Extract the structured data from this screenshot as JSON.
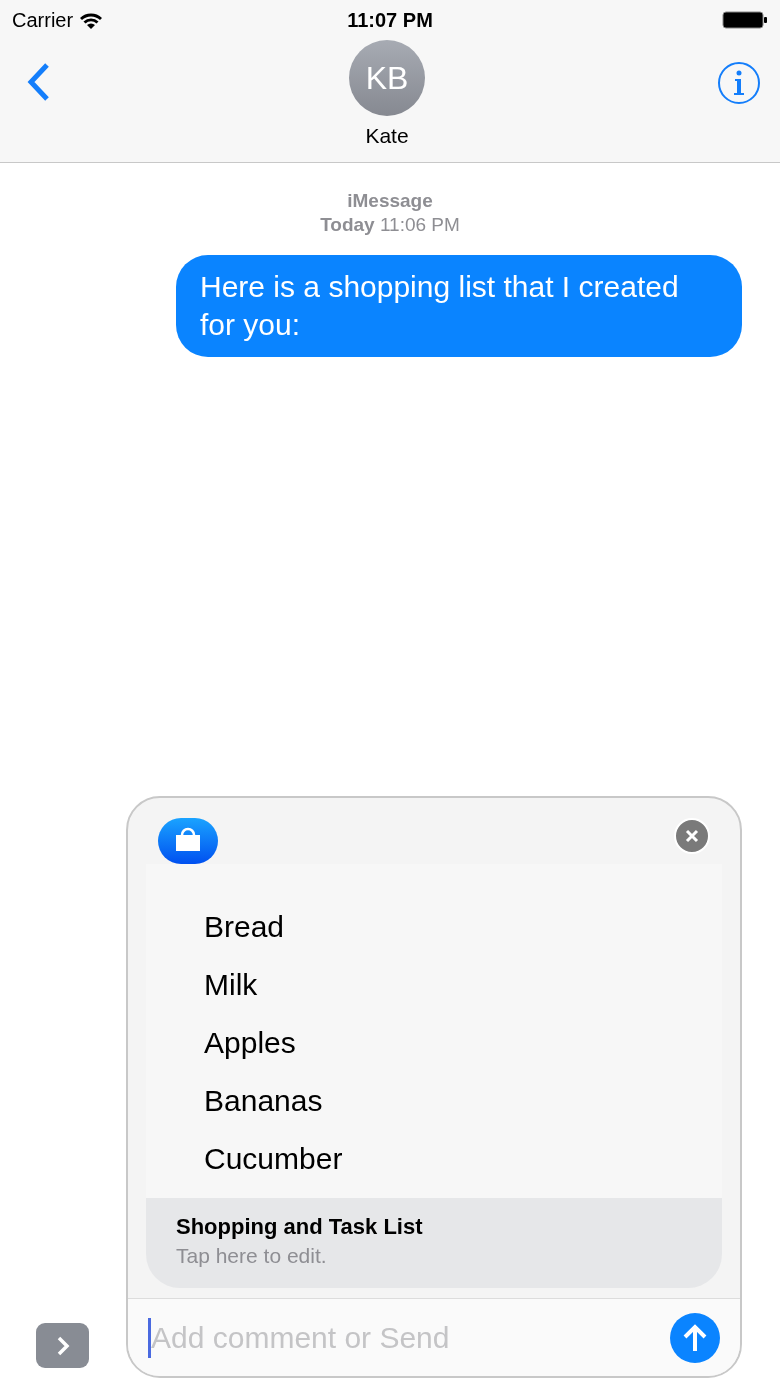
{
  "status_bar": {
    "carrier": "Carrier",
    "time": "11:07 PM"
  },
  "contact": {
    "initials": "KB",
    "name": "Kate"
  },
  "service": "iMessage",
  "timestamp": "**Today** 11:06 PM",
  "messages": [
    {
      "text": "Here is a shopping list that I created for you:",
      "outgoing": true
    }
  ],
  "card": {
    "items": [
      "Bread",
      "Milk",
      "Apples",
      "Bananas",
      "Cucumber"
    ],
    "title": "Shopping and Task List",
    "subtitle": "Tap here to edit."
  },
  "composer": {
    "placeholder": "Add comment or Send"
  }
}
